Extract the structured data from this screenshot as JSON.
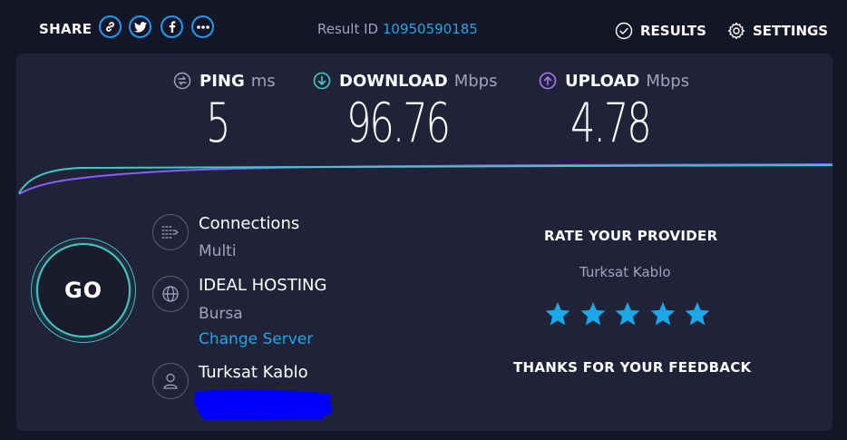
{
  "header": {
    "share_label": "SHARE",
    "share_icons": [
      "link-icon",
      "twitter-icon",
      "facebook-icon",
      "more-icon"
    ],
    "result_id_label": "Result ID",
    "result_id_value": "10950590185",
    "results_label": "RESULTS",
    "settings_label": "SETTINGS"
  },
  "metrics": {
    "ping": {
      "label": "PING",
      "unit": "ms",
      "value": "5",
      "icon": "ping-icon"
    },
    "download": {
      "label": "DOWNLOAD",
      "unit": "Mbps",
      "value": "96.76",
      "icon": "download-arrow-icon"
    },
    "upload": {
      "label": "UPLOAD",
      "unit": "Mbps",
      "value": "4.78",
      "icon": "upload-arrow-icon"
    }
  },
  "go_button": {
    "label": "GO"
  },
  "connections": {
    "title": "Connections",
    "mode": "Multi"
  },
  "server": {
    "name": "IDEAL HOSTING",
    "location": "Bursa",
    "change_label": "Change Server"
  },
  "provider": {
    "name": "Turksat Kablo"
  },
  "rating": {
    "title": "RATE YOUR PROVIDER",
    "provider": "Turksat Kablo",
    "stars": 5,
    "max_stars": 5,
    "feedback": "THANKS FOR YOUR FEEDBACK"
  },
  "colors": {
    "background": "#141526",
    "panel": "#202237",
    "accent_blue": "#1ca8e8",
    "download_teal": "#3fcac5",
    "upload_purple": "#8b5cf6",
    "star": "#1ca8e8",
    "redaction": "#0000ff"
  }
}
